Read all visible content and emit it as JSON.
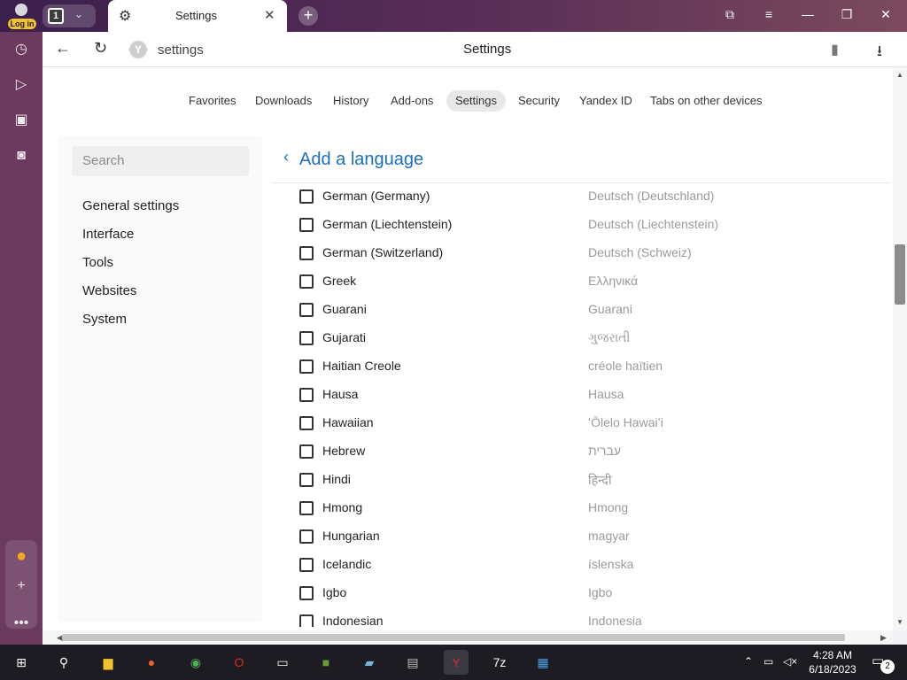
{
  "titlebar": {
    "login_label": "Log in",
    "tab_count": "1",
    "active_tab_title": "Settings"
  },
  "addressbar": {
    "url": "settings",
    "page_title": "Settings"
  },
  "topnav": {
    "items": [
      "Favorites",
      "Downloads",
      "History",
      "Add-ons",
      "Settings",
      "Security",
      "Yandex ID",
      "Tabs on other devices"
    ],
    "active": "Settings"
  },
  "leftpanel": {
    "search_placeholder": "Search",
    "menu": [
      "General settings",
      "Interface",
      "Tools",
      "Websites",
      "System"
    ]
  },
  "rightpanel": {
    "title": "Add a language",
    "languages": [
      {
        "name": "German (Germany)",
        "native": "Deutsch (Deutschland)"
      },
      {
        "name": "German (Liechtenstein)",
        "native": "Deutsch (Liechtenstein)"
      },
      {
        "name": "German (Switzerland)",
        "native": "Deutsch (Schweiz)"
      },
      {
        "name": "Greek",
        "native": "Ελληνικά"
      },
      {
        "name": "Guarani",
        "native": "Guarani"
      },
      {
        "name": "Gujarati",
        "native": "ગુજરાતી"
      },
      {
        "name": "Haitian Creole",
        "native": "créole haïtien"
      },
      {
        "name": "Hausa",
        "native": "Hausa"
      },
      {
        "name": "Hawaiian",
        "native": "ʻŌlelo Hawaiʻi"
      },
      {
        "name": "Hebrew",
        "native": "עברית"
      },
      {
        "name": "Hindi",
        "native": "हिन्दी"
      },
      {
        "name": "Hmong",
        "native": "Hmong"
      },
      {
        "name": "Hungarian",
        "native": "magyar"
      },
      {
        "name": "Icelandic",
        "native": "íslenska"
      },
      {
        "name": "Igbo",
        "native": "Igbo"
      },
      {
        "name": "Indonesian",
        "native": "Indonesia"
      }
    ]
  },
  "taskbar": {
    "time": "4:28 AM",
    "date": "6/18/2023",
    "notification_count": "2"
  }
}
